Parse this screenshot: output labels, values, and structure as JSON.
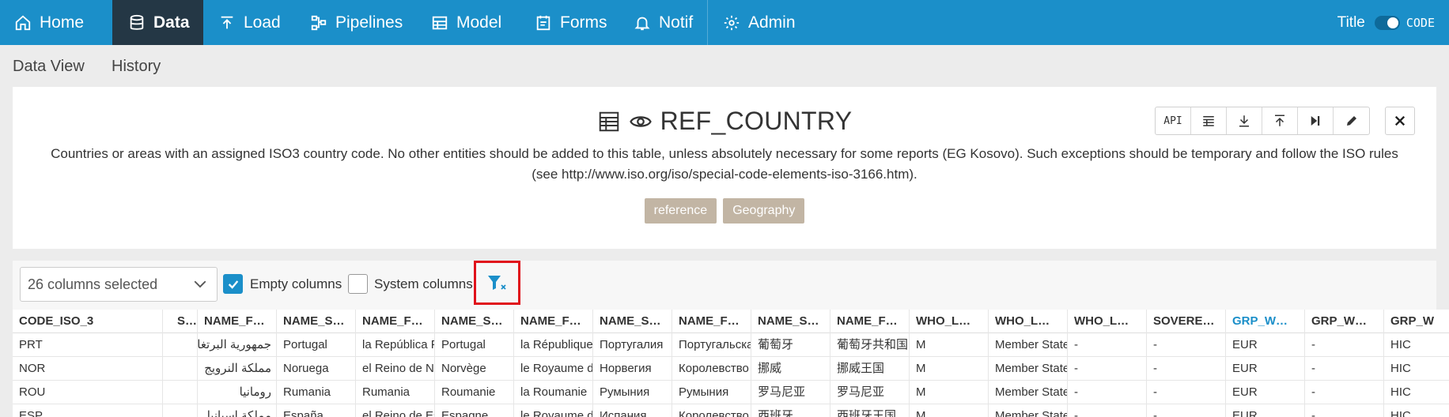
{
  "nav": {
    "items": [
      {
        "label": "Home",
        "icon": "home-icon"
      },
      {
        "label": "Data",
        "icon": "database-icon",
        "active": true
      },
      {
        "label": "Load",
        "icon": "upload-icon"
      },
      {
        "label": "Pipelines",
        "icon": "pipelines-icon"
      },
      {
        "label": "Model",
        "icon": "table-model-icon"
      },
      {
        "label": "Forms",
        "icon": "form-icon"
      },
      {
        "label": "Notif",
        "icon": "bell-icon"
      },
      {
        "label": "Admin",
        "icon": "gear-icon"
      }
    ],
    "title_label": "Title",
    "code_label": "CODE"
  },
  "subtabs": [
    "Data View",
    "History"
  ],
  "card": {
    "title": "REF_COUNTRY",
    "description": "Countries or areas with an assigned ISO3 country code. No other entities should be added to this table, unless absolutely necessary for some reports (EG Kosovo). Such exceptions should be temporary and follow the ISO rules (see http://www.iso.org/iso/special-code-elements-iso-3166.htm).",
    "tags": [
      "reference",
      "Geography"
    ],
    "toolbar": {
      "api_label": "API"
    }
  },
  "filters": {
    "columns_selected": "26 columns selected",
    "empty_columns_label": "Empty columns",
    "empty_columns_checked": true,
    "system_columns_label": "System columns",
    "system_columns_checked": false
  },
  "table": {
    "headers": [
      "CODE_ISO_3",
      "S…",
      "NAME_F…",
      "NAME_S…",
      "NAME_F…",
      "NAME_S…",
      "NAME_F…",
      "NAME_S…",
      "NAME_F…",
      "NAME_S…",
      "NAME_F…",
      "WHO_L…",
      "WHO_L…",
      "WHO_L…",
      "SOVERE…",
      "GRP_W…",
      "GRP_W…",
      "GRP_W"
    ],
    "rows": [
      [
        "PRT",
        "",
        "جمهورية البرتغال",
        "Portugal",
        "la República Portuguesa",
        "Portugal",
        "la République portugaise",
        "Португалия",
        "Португальская Республика",
        "葡萄牙",
        "葡萄牙共和国",
        "M",
        "Member State",
        "-",
        "-",
        "EUR",
        "-",
        "HIC"
      ],
      [
        "NOR",
        "",
        "مملكة النرويج",
        "Noruega",
        "el Reino de Noruega",
        "Norvège",
        "le Royaume de Norvège",
        "Норвегия",
        "Королевство Норвегия",
        "挪威",
        "挪威王国",
        "M",
        "Member State",
        "-",
        "-",
        "EUR",
        "-",
        "HIC"
      ],
      [
        "ROU",
        "",
        "رومانيا",
        "Rumania",
        "Rumania",
        "Roumanie",
        "la Roumanie",
        "Румыния",
        "Румыния",
        "罗马尼亚",
        "罗马尼亚",
        "M",
        "Member State",
        "-",
        "-",
        "EUR",
        "-",
        "HIC"
      ],
      [
        "ESP",
        "",
        "مملكة إسبانيا",
        "España",
        "el Reino de España",
        "Espagne",
        "le Royaume d'Espagne",
        "Испания",
        "Королевство Испания",
        "西班牙",
        "西班牙王国",
        "M",
        "Member State",
        "-",
        "-",
        "EUR",
        "-",
        "HIC"
      ]
    ]
  },
  "colors": {
    "nav_bg": "#1b8fc9",
    "nav_active": "#243745",
    "tag_bg": "#c2b5a4",
    "highlight": "#e0121b"
  }
}
